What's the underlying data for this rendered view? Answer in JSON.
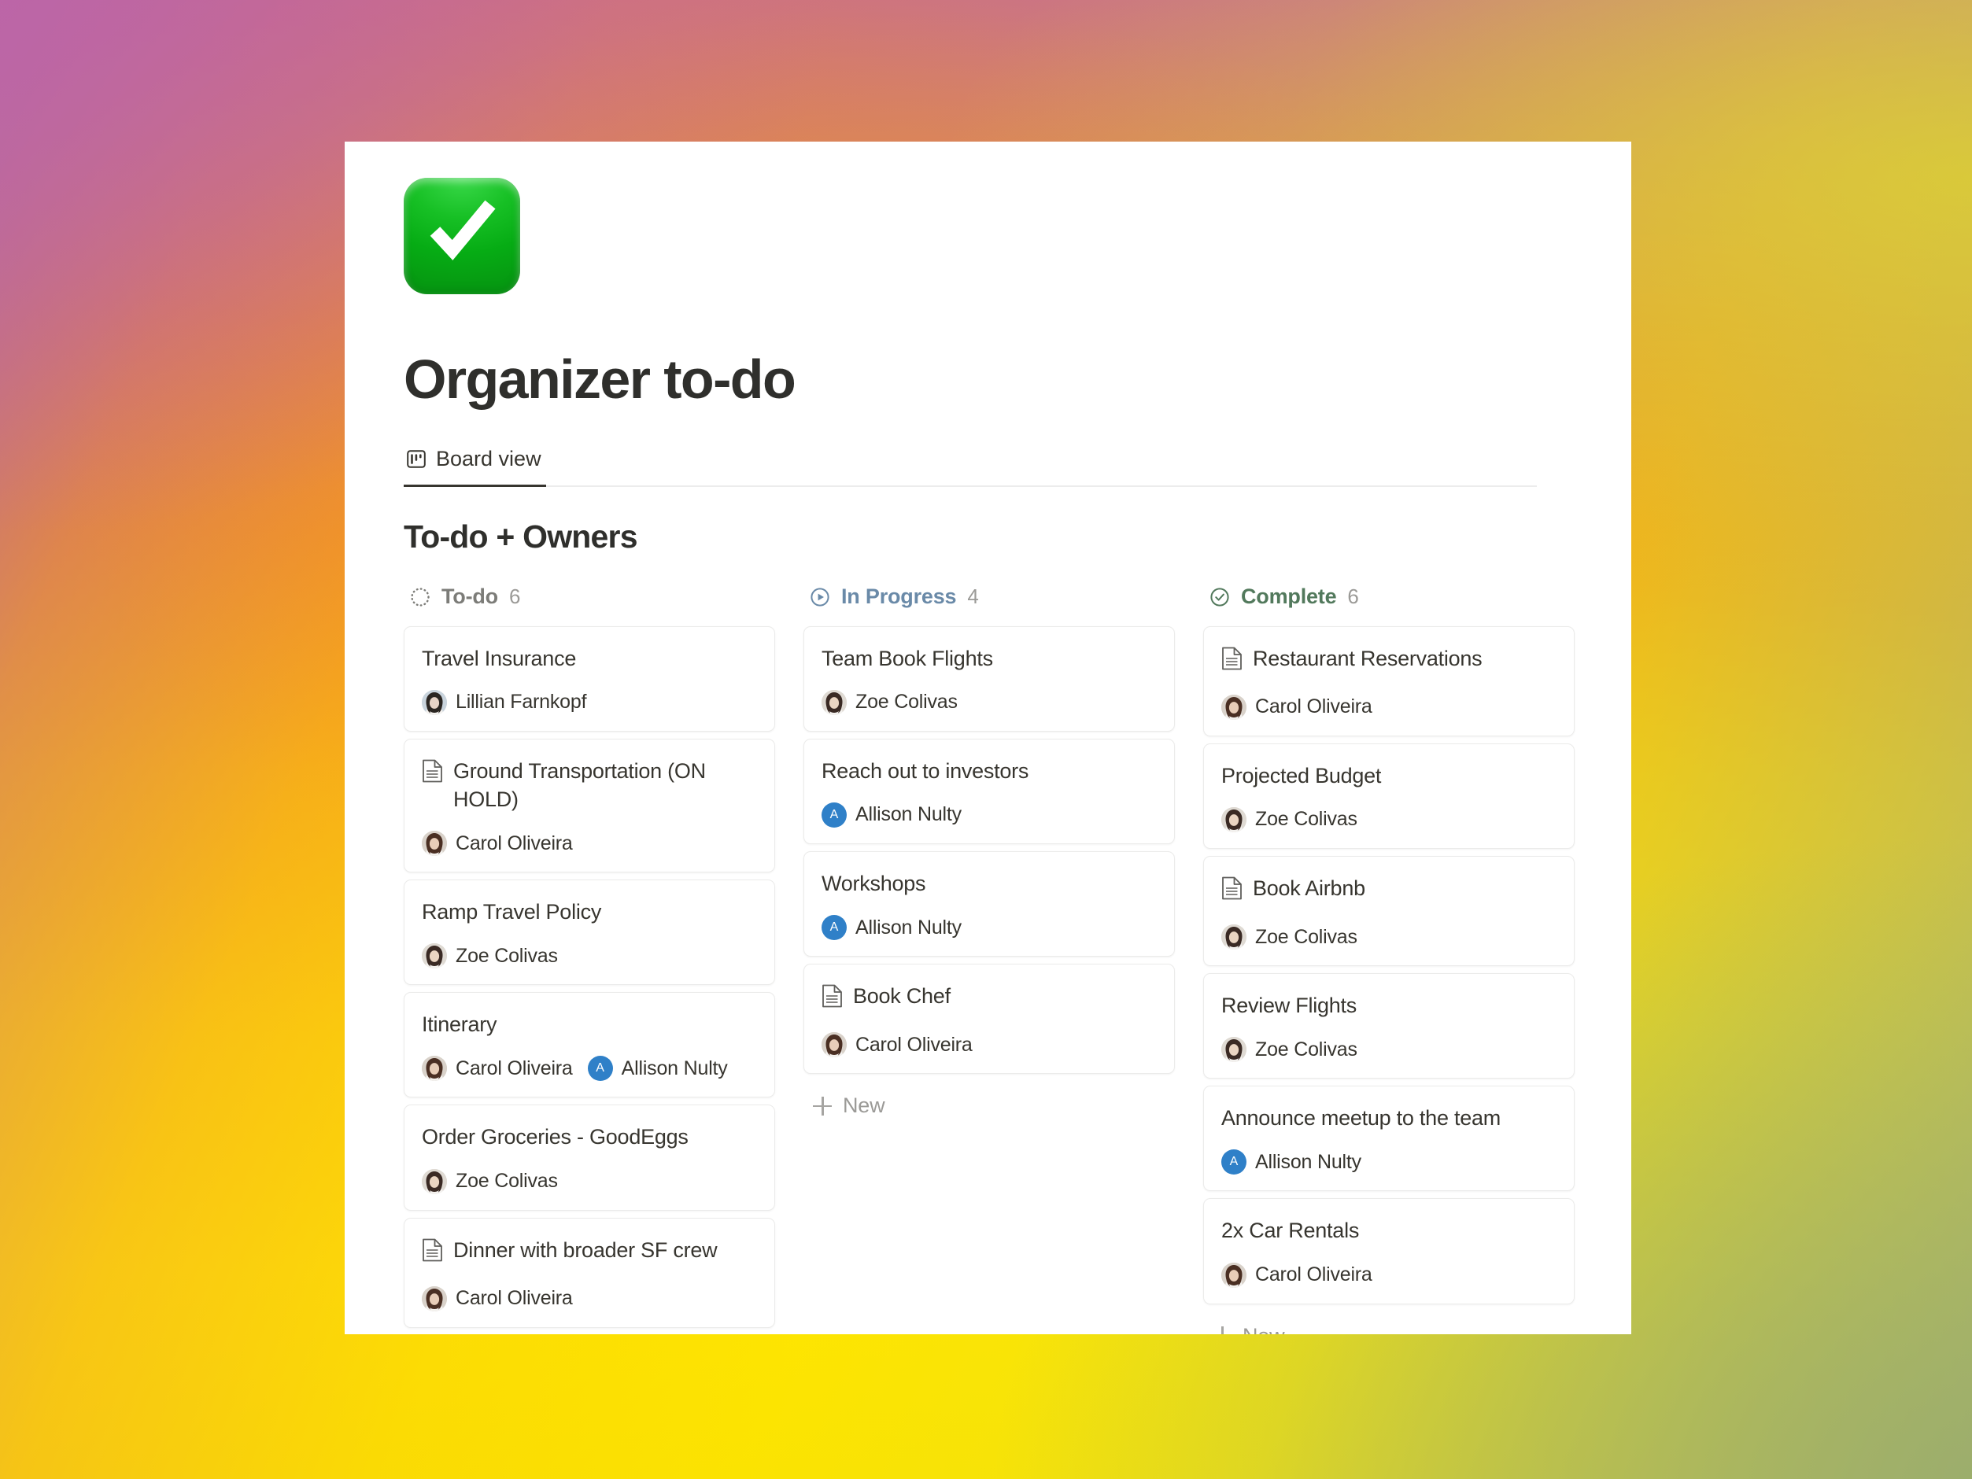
{
  "page": {
    "icon": "green-check-mark-emoji",
    "title": "Organizer to-do",
    "view_tab": {
      "label": "Board view",
      "icon": "board-view-icon"
    },
    "board_title": "To-do + Owners"
  },
  "colors": {
    "status_todo": "#7c7c78",
    "status_in_progress": "#6a8aa8",
    "status_complete": "#52795c",
    "avatar_initial_bg": "#2f80c8",
    "card_border": "#ebebea",
    "panel_bg": "#ffffff"
  },
  "new_button_label": "New",
  "columns": [
    {
      "id": "todo",
      "name": "To-do",
      "count": "6",
      "icon": "dotted-circle-icon",
      "cards": [
        {
          "title": "Travel Insurance",
          "doc_icon": false,
          "owners": [
            {
              "name": "Lillian Farnkopf",
              "avatar": "photo"
            }
          ]
        },
        {
          "title": "Ground Transportation (ON HOLD)",
          "doc_icon": true,
          "owners": [
            {
              "name": "Carol Oliveira",
              "avatar": "photo"
            }
          ]
        },
        {
          "title": "Ramp Travel Policy",
          "doc_icon": false,
          "owners": [
            {
              "name": "Zoe Colivas",
              "avatar": "photo"
            }
          ]
        },
        {
          "title": "Itinerary",
          "doc_icon": false,
          "owners": [
            {
              "name": "Carol Oliveira",
              "avatar": "photo"
            },
            {
              "name": "Allison Nulty",
              "avatar": "initial",
              "initial": "A"
            }
          ]
        },
        {
          "title": "Order Groceries - GoodEggs",
          "doc_icon": false,
          "owners": [
            {
              "name": "Zoe Colivas",
              "avatar": "photo"
            }
          ]
        },
        {
          "title": "Dinner with broader SF crew",
          "doc_icon": true,
          "owners": [
            {
              "name": "Carol Oliveira",
              "avatar": "photo"
            }
          ]
        }
      ]
    },
    {
      "id": "in-progress",
      "name": "In Progress",
      "count": "4",
      "icon": "play-circle-icon",
      "cards": [
        {
          "title": "Team Book Flights",
          "doc_icon": false,
          "owners": [
            {
              "name": "Zoe Colivas",
              "avatar": "photo"
            }
          ]
        },
        {
          "title": "Reach out to investors",
          "doc_icon": false,
          "owners": [
            {
              "name": "Allison Nulty",
              "avatar": "initial",
              "initial": "A"
            }
          ]
        },
        {
          "title": "Workshops",
          "doc_icon": false,
          "owners": [
            {
              "name": "Allison Nulty",
              "avatar": "initial",
              "initial": "A"
            }
          ]
        },
        {
          "title": "Book Chef",
          "doc_icon": true,
          "owners": [
            {
              "name": "Carol Oliveira",
              "avatar": "photo"
            }
          ]
        }
      ]
    },
    {
      "id": "complete",
      "name": "Complete",
      "count": "6",
      "icon": "check-circle-icon",
      "cards": [
        {
          "title": "Restaurant Reservations",
          "doc_icon": true,
          "owners": [
            {
              "name": "Carol Oliveira",
              "avatar": "photo"
            }
          ]
        },
        {
          "title": "Projected Budget",
          "doc_icon": false,
          "owners": [
            {
              "name": "Zoe Colivas",
              "avatar": "photo"
            }
          ]
        },
        {
          "title": "Book Airbnb",
          "doc_icon": true,
          "owners": [
            {
              "name": "Zoe Colivas",
              "avatar": "photo"
            }
          ]
        },
        {
          "title": "Review Flights",
          "doc_icon": false,
          "owners": [
            {
              "name": "Zoe Colivas",
              "avatar": "photo"
            }
          ]
        },
        {
          "title": "Announce meetup to the team",
          "doc_icon": false,
          "owners": [
            {
              "name": "Allison Nulty",
              "avatar": "initial",
              "initial": "A"
            }
          ]
        },
        {
          "title": "2x Car Rentals",
          "doc_icon": false,
          "owners": [
            {
              "name": "Carol Oliveira",
              "avatar": "photo"
            }
          ]
        }
      ]
    }
  ]
}
